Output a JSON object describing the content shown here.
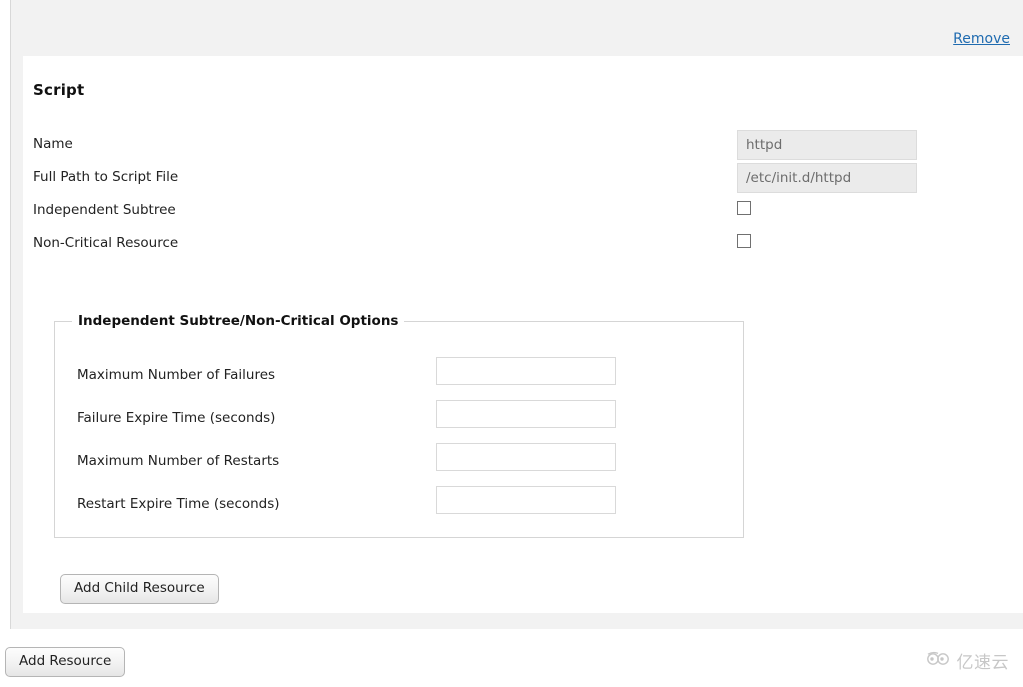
{
  "resource": {
    "remove_label": "Remove",
    "title": "Script",
    "fields": [
      {
        "label": "Name",
        "control": "text",
        "value": "httpd",
        "placeholder": "httpd",
        "name": "script-name"
      },
      {
        "label": "Full Path to Script File",
        "control": "text",
        "value": "/etc/init.d/httpd",
        "placeholder": "/etc/init.d/httpd",
        "name": "script-path"
      },
      {
        "label": "Independent Subtree",
        "control": "checkbox",
        "checked": false,
        "name": "independent-subtree"
      },
      {
        "label": "Non-Critical Resource",
        "control": "checkbox",
        "checked": false,
        "name": "non-critical-resource"
      }
    ],
    "options_fieldset": {
      "legend": "Independent Subtree/Non-Critical Options",
      "fields": [
        {
          "label": "Maximum Number of Failures",
          "value": "",
          "name": "max-failures"
        },
        {
          "label": "Failure Expire Time (seconds)",
          "value": "",
          "name": "failure-expire-time"
        },
        {
          "label": "Maximum Number of Restarts",
          "value": "",
          "name": "max-restarts"
        },
        {
          "label": "Restart Expire Time (seconds)",
          "value": "",
          "name": "restart-expire-time"
        }
      ]
    },
    "add_child_label": "Add Child Resource"
  },
  "page": {
    "add_resource_label": "Add Resource"
  },
  "watermark": {
    "text": "亿速云",
    "icon": "cloud-icon"
  },
  "colors": {
    "link": "#1f6bb0",
    "panel_bg": "#ffffff",
    "container_bg": "#f2f2f2",
    "disabled_input_bg": "#ebebeb",
    "disabled_input_text": "#6d6d6d",
    "fieldset_border": "#d5d5d5"
  }
}
